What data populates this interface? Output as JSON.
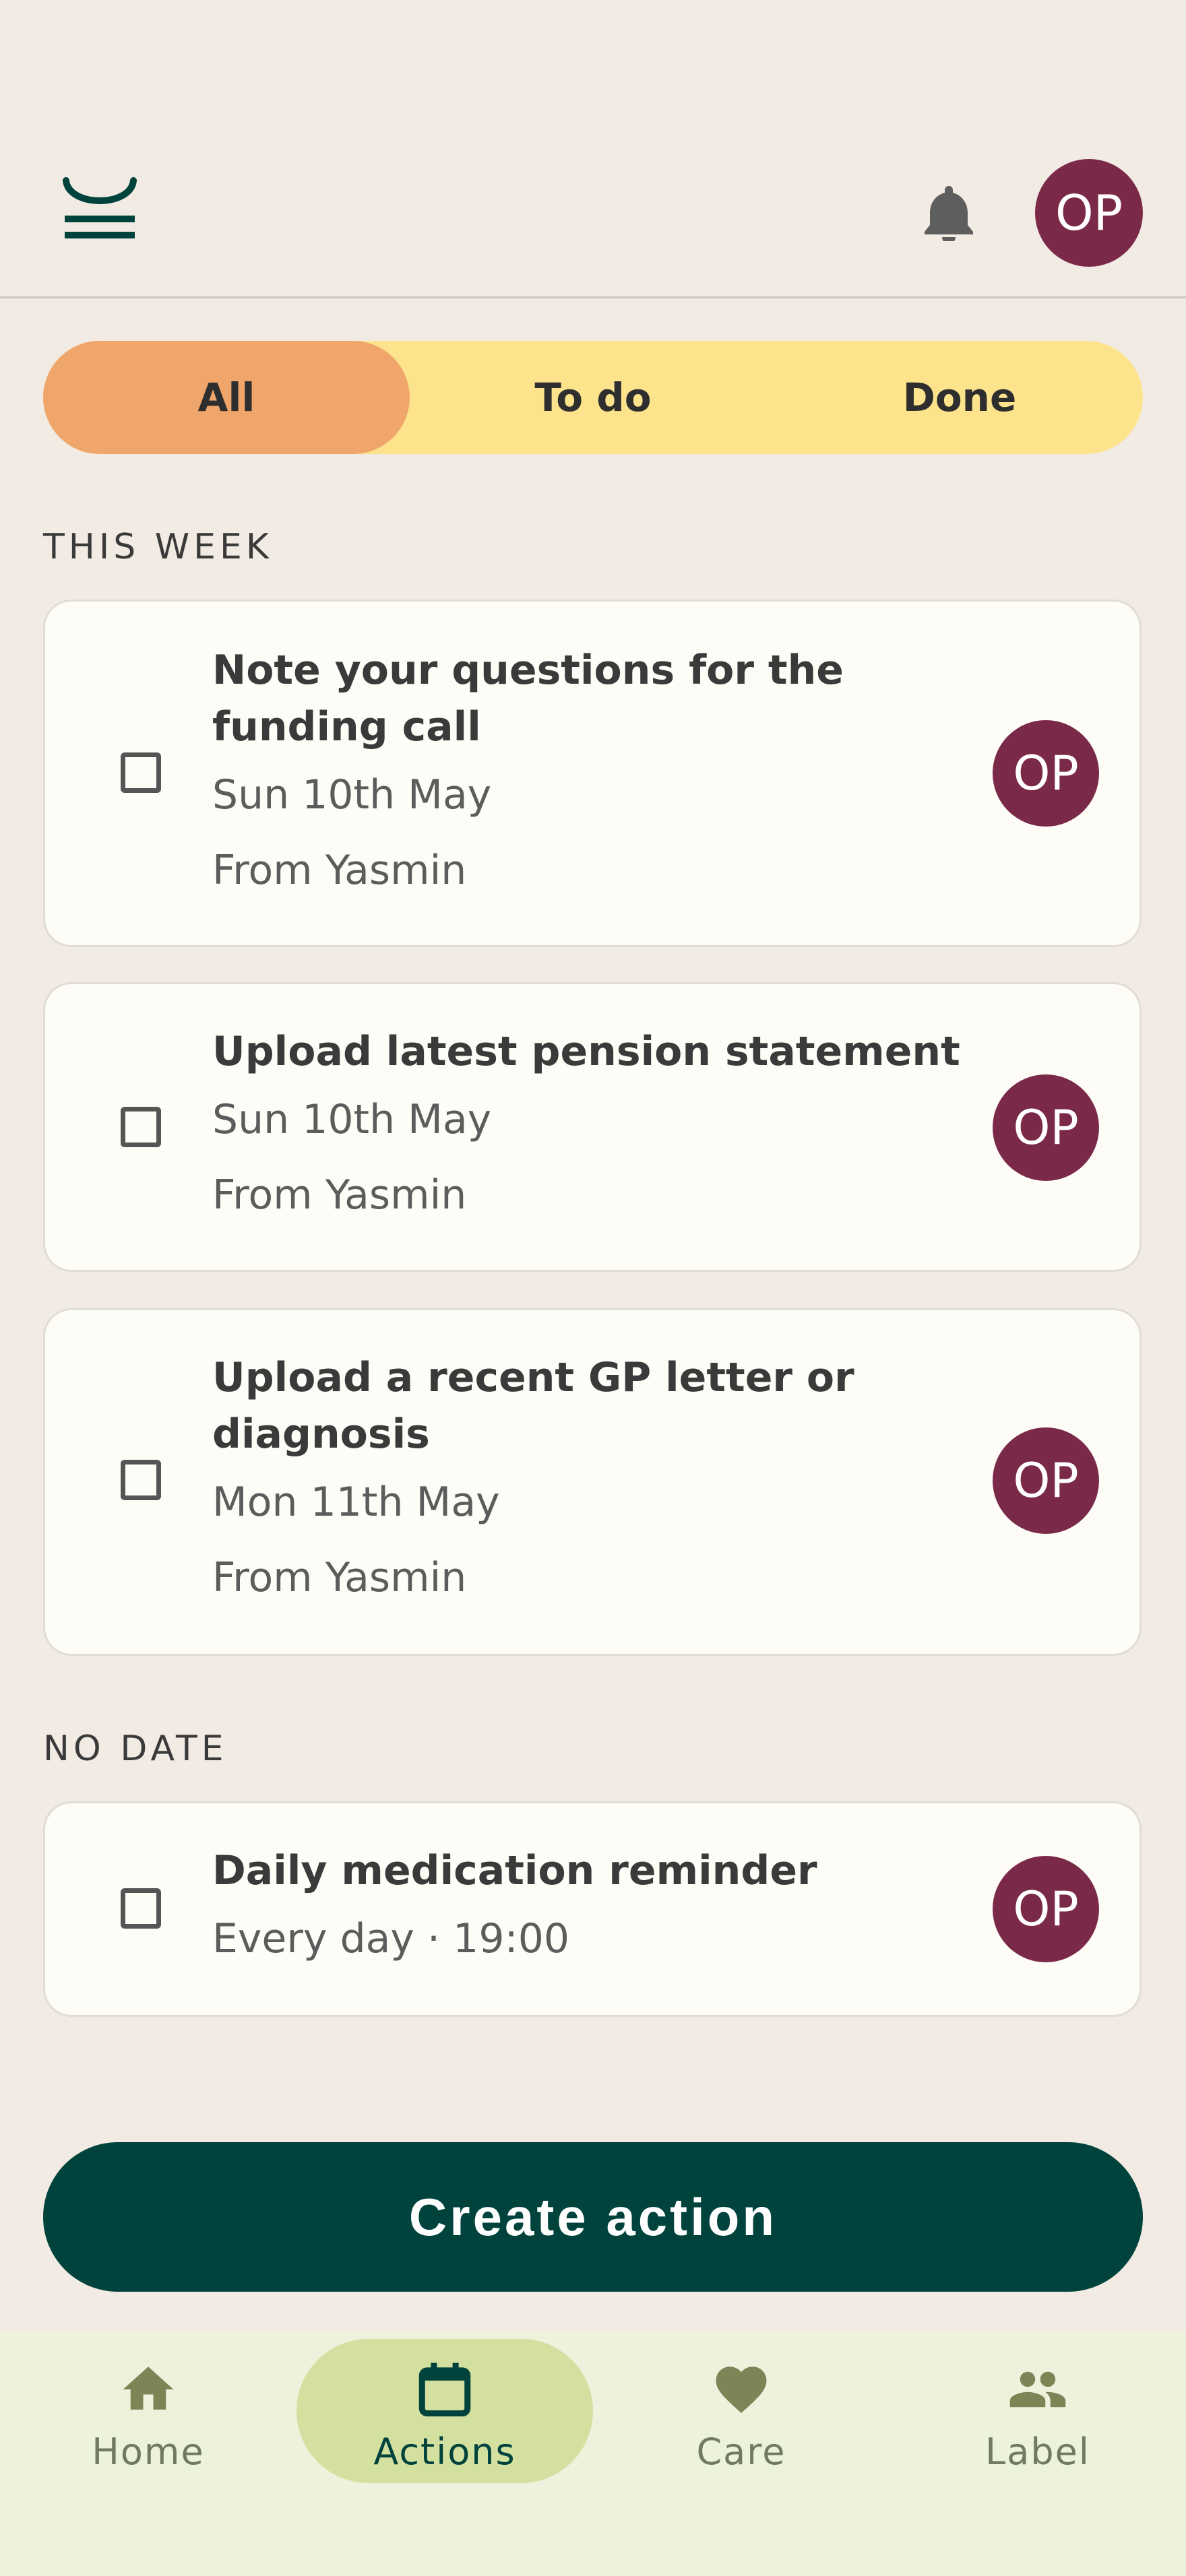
{
  "header": {
    "logo_icon": "app-logo-icon",
    "notification_icon": "bell-icon",
    "avatar_initials": "OP"
  },
  "filters": {
    "items": [
      {
        "label": "All",
        "active": true
      },
      {
        "label": "To do",
        "active": false
      },
      {
        "label": "Done",
        "active": false
      }
    ]
  },
  "sections": [
    {
      "label": "THIS WEEK",
      "cards": [
        {
          "title": "Note your questions for the funding call",
          "date": "Sun 10th May",
          "from": "From Yasmin",
          "avatar": "OP"
        },
        {
          "title": "Upload latest pension statement",
          "date": "Sun 10th May",
          "from": "From Yasmin",
          "avatar": "OP"
        },
        {
          "title": "Upload a recent GP letter or diagnosis",
          "date": "Mon 11th May",
          "from": "From Yasmin",
          "avatar": "OP"
        }
      ]
    },
    {
      "label": "NO DATE",
      "cards": [
        {
          "title": "Daily medication reminder",
          "date": "Every day · 19:00",
          "avatar": "OP"
        }
      ]
    }
  ],
  "create_button": {
    "label": "Create action"
  },
  "bottom_nav": {
    "items": [
      {
        "label": "Home",
        "icon": "home-icon",
        "active": false
      },
      {
        "label": "Actions",
        "icon": "calendar-icon",
        "active": true
      },
      {
        "label": "Care",
        "icon": "heart-icon",
        "active": false
      },
      {
        "label": "Label",
        "icon": "people-icon",
        "active": false
      }
    ]
  },
  "colors": {
    "background": "#f1ebe3",
    "brand_dark": "#00433c",
    "avatar": "#7a2a48",
    "filter_active": "#f0a56a",
    "filter_bg": "#fde48c",
    "nav_bg": "#edf2dc",
    "nav_pill": "#d3e09f"
  }
}
